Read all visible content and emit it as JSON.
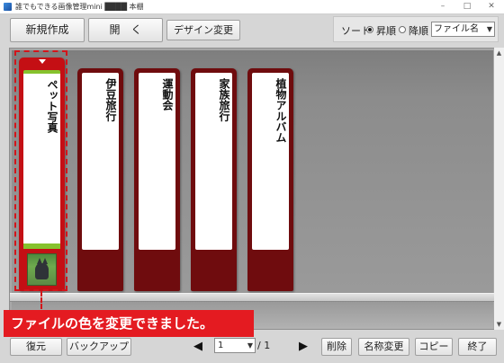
{
  "window": {
    "title": "誰でもできる画像管理mini ████ 本棚",
    "minimize": "–",
    "maximize": "□",
    "close": "✕"
  },
  "toolbar": {
    "new_label": "新規作成",
    "open_label": "開　く",
    "design_label": "デザイン変更"
  },
  "sort": {
    "label": "ソート",
    "asc_label": "昇順",
    "desc_label": "降順",
    "selected": "ascending",
    "field": "ファイル名"
  },
  "binders": [
    {
      "title": "ペット写真",
      "color": "#c40f14",
      "selected": true
    },
    {
      "title": "伊豆旅行",
      "color": "#6f0c0e",
      "selected": false
    },
    {
      "title": "運動会",
      "color": "#6f0c0e",
      "selected": false
    },
    {
      "title": "家族旅行",
      "color": "#6f0c0e",
      "selected": false
    },
    {
      "title": "植物アルバム",
      "color": "#6f0c0e",
      "selected": false
    }
  ],
  "callout": {
    "text": "ファイルの色を変更できました。",
    "color": "#e41b21"
  },
  "bottom": {
    "restore_label": "復元",
    "backup_label": "バックアップ",
    "page_current": "1",
    "page_total": "/ 1",
    "delete_label": "削除",
    "rename_label": "名称変更",
    "copy_label": "コピー",
    "exit_label": "終了"
  }
}
